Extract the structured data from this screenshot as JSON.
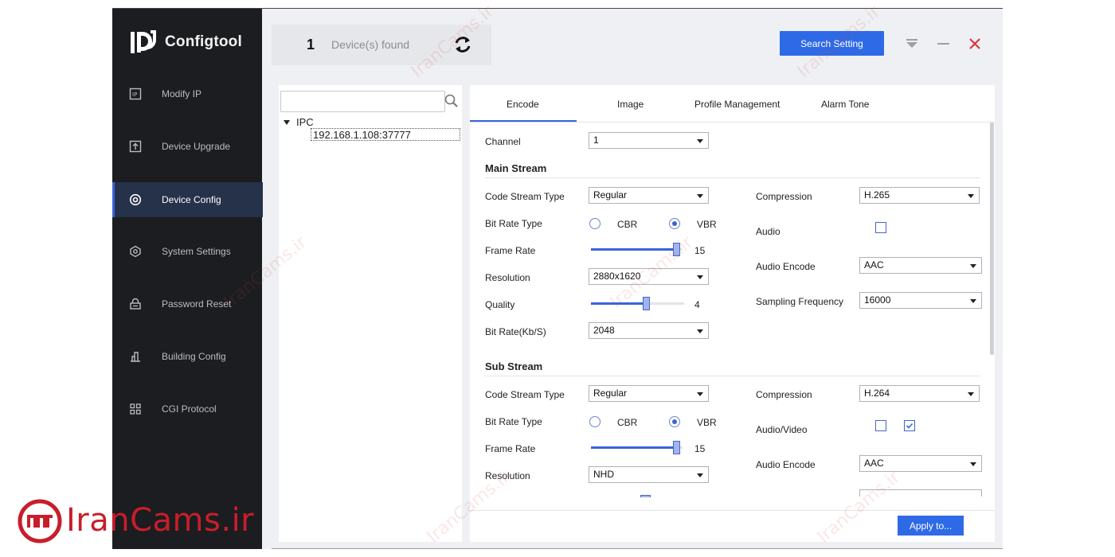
{
  "app": {
    "title": "Configtool"
  },
  "sidebar": {
    "items": [
      {
        "label": "Modify IP",
        "icon": "ip-icon"
      },
      {
        "label": "Device Upgrade",
        "icon": "upload-icon"
      },
      {
        "label": "Device Config",
        "icon": "target-icon",
        "active": true
      },
      {
        "label": "System Settings",
        "icon": "hex-settings-icon"
      },
      {
        "label": "Password Reset",
        "icon": "lock-reset-icon"
      },
      {
        "label": "Building Config",
        "icon": "building-icon"
      },
      {
        "label": "CGI Protocol",
        "icon": "grid-icon"
      }
    ]
  },
  "header": {
    "device_count": "1",
    "found_label": "Device(s) found",
    "search_setting": "Search Setting"
  },
  "tree": {
    "search_value": "",
    "root": "IPC",
    "device": "192.168.1.108:37777"
  },
  "tabs": [
    "Encode",
    "Image",
    "Profile Management",
    "Alarm Tone"
  ],
  "encode": {
    "channel_label": "Channel",
    "channel_value": "1",
    "main_stream": {
      "title": "Main Stream",
      "code_stream_type_label": "Code Stream Type",
      "code_stream_type": "Regular",
      "bit_rate_type_label": "Bit Rate Type",
      "cbr": "CBR",
      "vbr": "VBR",
      "bit_rate_type_selected": "VBR",
      "frame_rate_label": "Frame Rate",
      "frame_rate": "15",
      "frame_rate_fraction": 1.0,
      "resolution_label": "Resolution",
      "resolution": "2880x1620",
      "quality_label": "Quality",
      "quality": "4",
      "quality_fraction": 0.6,
      "bit_rate_label": "Bit Rate(Kb/S)",
      "bit_rate": "2048",
      "compression_label": "Compression",
      "compression": "H.265",
      "audio_label": "Audio",
      "audio_checked": false,
      "audio_encode_label": "Audio Encode",
      "audio_encode": "AAC",
      "sampling_frequency_label": "Sampling Frequency",
      "sampling_frequency": "16000"
    },
    "sub_stream": {
      "title": "Sub Stream",
      "code_stream_type_label": "Code Stream Type",
      "code_stream_type": "Regular",
      "bit_rate_type_label": "Bit Rate Type",
      "cbr": "CBR",
      "vbr": "VBR",
      "bit_rate_type_selected": "VBR",
      "frame_rate_label": "Frame Rate",
      "frame_rate": "15",
      "frame_rate_fraction": 1.0,
      "resolution_label": "Resolution",
      "resolution": "NHD",
      "compression_label": "Compression",
      "compression": "H.264",
      "audio_video_label": "Audio/Video",
      "audio_checked": false,
      "video_checked": true,
      "audio_encode_label": "Audio Encode",
      "audio_encode": "AAC"
    }
  },
  "footer": {
    "apply_to": "Apply to..."
  },
  "watermark": {
    "brand": "IranCams.ir",
    "faint": "IranCams.ir"
  },
  "colors": {
    "accent": "#2f6ae6",
    "sidebar_bg": "#1c1d20",
    "brand_red": "#c81e2a"
  }
}
